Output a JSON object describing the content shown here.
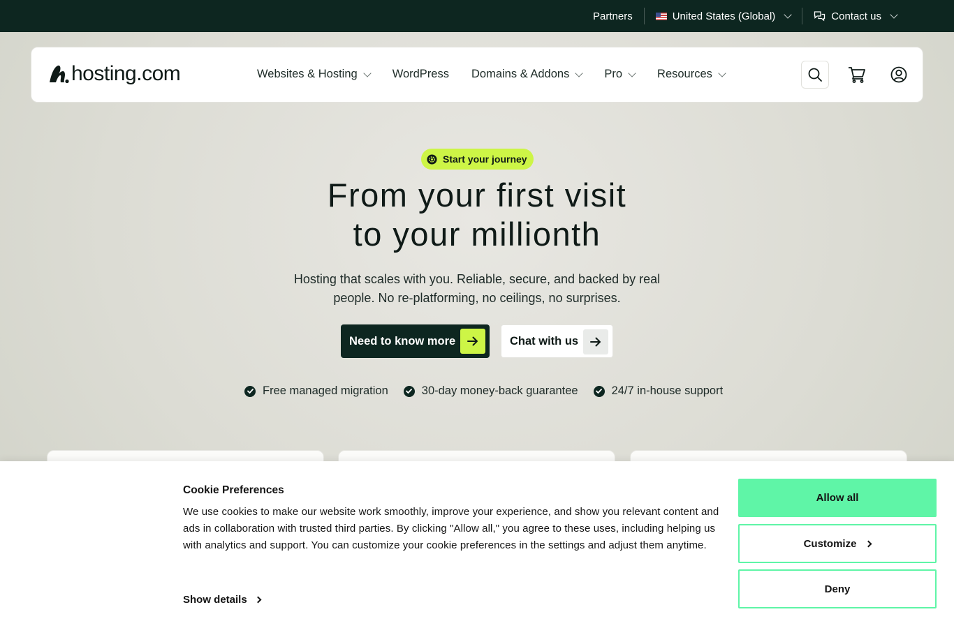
{
  "topbar": {
    "partners": "Partners",
    "region": "United States (Global)",
    "contact": "Contact us"
  },
  "nav": {
    "logo_text": "hosting.com",
    "items": [
      {
        "label": "Websites & Hosting",
        "has_dropdown": true
      },
      {
        "label": "WordPress",
        "has_dropdown": false
      },
      {
        "label": "Domains & Addons",
        "has_dropdown": true
      },
      {
        "label": "Pro",
        "has_dropdown": true
      },
      {
        "label": "Resources",
        "has_dropdown": true
      }
    ],
    "icons": [
      "search-icon",
      "cart-icon",
      "account-icon"
    ]
  },
  "hero": {
    "badge": "Start your journey",
    "title_line1": "From your first visit",
    "title_line2": "to your millionth",
    "subtitle": "Hosting that scales with you. Reliable, secure, and backed by real people. No re-platforming, no ceilings, no surprises.",
    "primary_cta": "Need to know more",
    "secondary_cta": "Chat with us",
    "features": [
      "Free managed migration",
      "30-day money-back guarantee",
      "24/7 in-house support"
    ]
  },
  "cookie": {
    "title": "Cookie Preferences",
    "text": "We use cookies to make our website work smoothly, improve your experience, and show you relevant content and ads in collaboration with trusted third parties. By clicking \"Allow all,\" you agree to these uses, including helping us with analytics and support. You can customize your cookie preferences in the settings and adjust them anytime.",
    "show_details": "Show details",
    "allow_all": "Allow all",
    "customize": "Customize",
    "deny": "Deny"
  },
  "colors": {
    "topbar_bg": "#0d2620",
    "accent_lime": "#cdf546",
    "cookie_accent": "#5ff5a7"
  }
}
